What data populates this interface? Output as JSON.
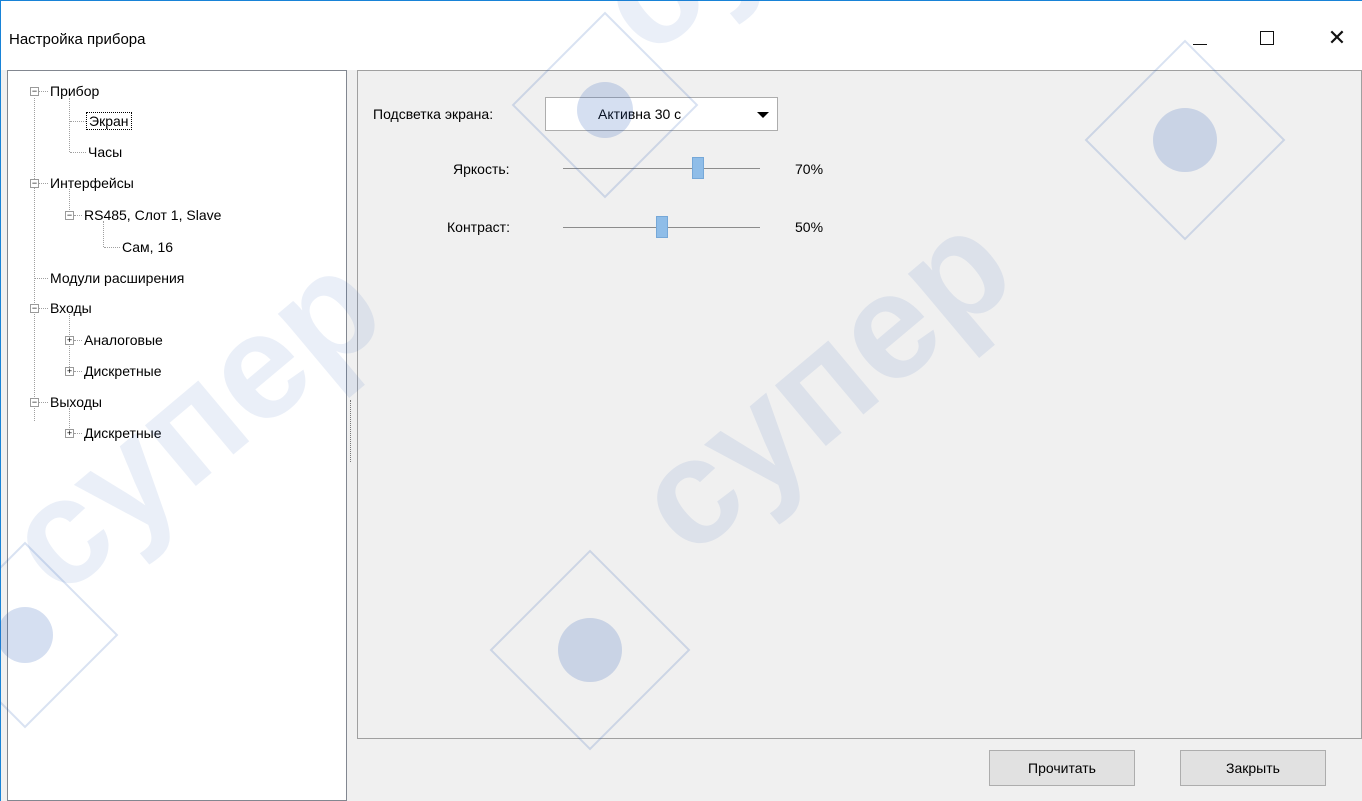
{
  "window": {
    "title": "Настройка прибора",
    "controls": {
      "minimize_icon": "minimize-icon",
      "maximize_icon": "maximize-icon",
      "close_icon": "close-icon",
      "close_glyph": "✕"
    }
  },
  "tree": {
    "items": [
      {
        "label": "Прибор",
        "expanded": true
      },
      {
        "label": "Экран",
        "selected": true
      },
      {
        "label": "Часы"
      },
      {
        "label": "Интерфейсы",
        "expanded": true
      },
      {
        "label": "RS485, Слот 1, Slave",
        "expanded": true
      },
      {
        "label": "Сам, 16"
      },
      {
        "label": "Модули расширения"
      },
      {
        "label": "Входы",
        "expanded": true
      },
      {
        "label": "Аналоговые",
        "expanded": false
      },
      {
        "label": "Дискретные",
        "expanded": false
      },
      {
        "label": "Выходы",
        "expanded": true
      },
      {
        "label": "Дискретные",
        "expanded": false
      }
    ],
    "expander_minus": "−",
    "expander_plus": "+"
  },
  "settings": {
    "backlight": {
      "label": "Подсветка экрана:",
      "value": "Активна 30 с"
    },
    "brightness": {
      "label": "Яркость:",
      "value_text": "70%",
      "level": 0.7
    },
    "contrast": {
      "label": "Контраст:",
      "value_text": "50%",
      "level": 0.5
    }
  },
  "buttons": {
    "read": "Прочитать",
    "close": "Закрыть"
  },
  "colors": {
    "accent": "#1883d7",
    "slider_thumb": "#8fbde8",
    "watermark": "#2f5fb8"
  },
  "watermark": {
    "text": "cупер"
  }
}
